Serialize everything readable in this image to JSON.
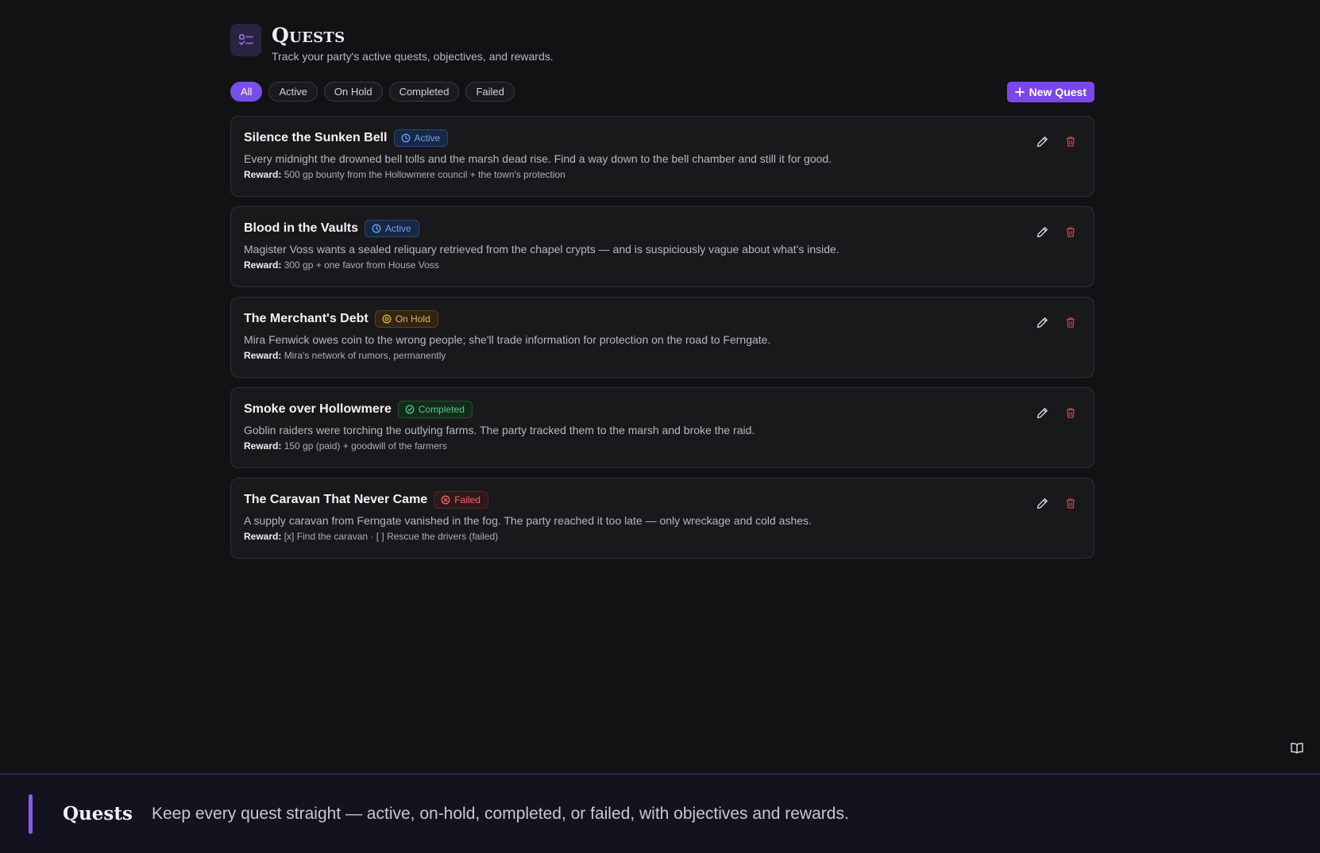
{
  "header": {
    "title": "Quests",
    "subtitle": "Track your party's active quests, objectives, and rewards.",
    "icon": "list-check-icon"
  },
  "filters": [
    {
      "label": "All",
      "selected": true
    },
    {
      "label": "Active",
      "selected": false
    },
    {
      "label": "On Hold",
      "selected": false
    },
    {
      "label": "Completed",
      "selected": false
    },
    {
      "label": "Failed",
      "selected": false
    }
  ],
  "new_quest_label": "New Quest",
  "reward_label": "Reward:",
  "quests": [
    {
      "title": "Silence the Sunken Bell",
      "status": "Active",
      "description": "Every midnight the drowned bell tolls and the marsh dead rise. Find a way down to the bell chamber and still it for good.",
      "reward": "500 gp bounty from the Hollowmere council + the town's protection"
    },
    {
      "title": "Blood in the Vaults",
      "status": "Active",
      "description": "Magister Voss wants a sealed reliquary retrieved from the chapel crypts — and is suspiciously vague about what's inside.",
      "reward": "300 gp + one favor from House Voss"
    },
    {
      "title": "The Merchant's Debt",
      "status": "On Hold",
      "description": "Mira Fenwick owes coin to the wrong people; she'll trade information for protection on the road to Ferngate.",
      "reward": "Mira's network of rumors, permanently"
    },
    {
      "title": "Smoke over Hollowmere",
      "status": "Completed",
      "description": "Goblin raiders were torching the outlying farms. The party tracked them to the marsh and broke the raid.",
      "reward": "150 gp (paid) + goodwill of the farmers"
    },
    {
      "title": "The Caravan That Never Came",
      "status": "Failed",
      "description": "A supply caravan from Ferngate vanished in the fog. The party reached it too late — only wreckage and cold ashes.",
      "reward": "[x] Find the caravan · [ ] Rescue the drivers (failed)"
    }
  ],
  "footer": {
    "title": "Quests",
    "text": "Keep every quest straight — active, on-hold, completed, or failed, with objectives and rewards."
  },
  "colors": {
    "accent": "#7b47ec",
    "active": "#6aa3f5",
    "on_hold": "#e8b34a",
    "completed": "#55c97a",
    "failed": "#ee6b6b"
  }
}
